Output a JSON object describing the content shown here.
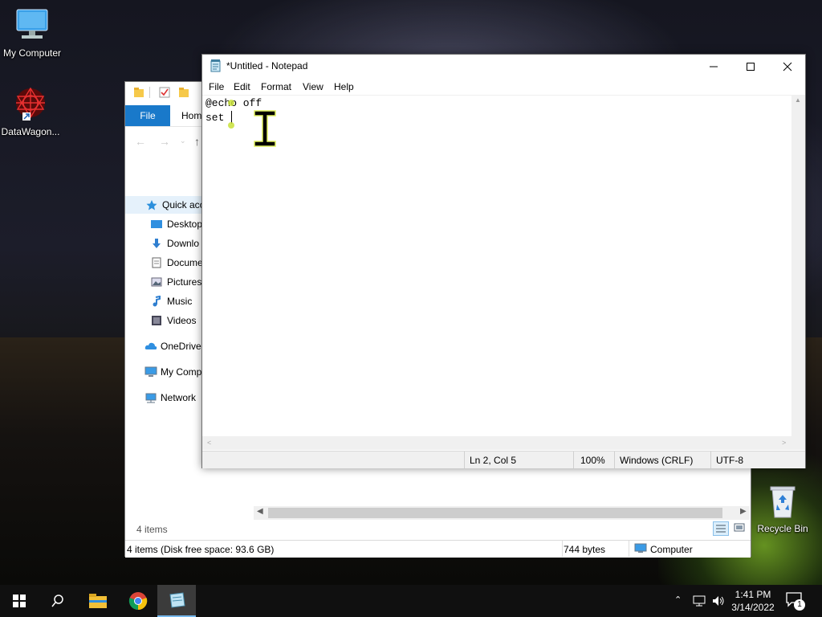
{
  "desktop": {
    "icons": [
      {
        "label": "My Computer",
        "icon": "my-computer-icon"
      },
      {
        "label": "DataWagon...",
        "icon": "datawagon-icon"
      },
      {
        "label": "Recycle Bin",
        "icon": "recycle-bin-icon"
      }
    ]
  },
  "explorer": {
    "tabs": {
      "file": "File",
      "home": "Hom"
    },
    "nav_items": [
      {
        "label": "Quick acc",
        "icon": "star-icon"
      },
      {
        "label": "Desktop",
        "icon": "desktop-folder-icon"
      },
      {
        "label": "Downlo",
        "icon": "download-icon"
      },
      {
        "label": "Docume",
        "icon": "document-icon"
      },
      {
        "label": "Pictures",
        "icon": "pictures-icon"
      },
      {
        "label": "Music",
        "icon": "music-icon"
      },
      {
        "label": "Videos",
        "icon": "video-icon"
      },
      {
        "label": "OneDrive",
        "icon": "onedrive-icon"
      },
      {
        "label": "My Comp",
        "icon": "computer-icon"
      },
      {
        "label": "Network",
        "icon": "network-icon"
      }
    ],
    "item_count": "4 items",
    "status": {
      "left": "4 items (Disk free space: 93.6 GB)",
      "size": "744 bytes",
      "location": "Computer"
    }
  },
  "notepad": {
    "title": "*Untitled - Notepad",
    "menu": [
      "File",
      "Edit",
      "Format",
      "View",
      "Help"
    ],
    "lines": [
      "@echo off",
      "set "
    ],
    "status": {
      "position": "Ln 2, Col 5",
      "zoom": "100%",
      "line_ending": "Windows (CRLF)",
      "encoding": "UTF-8"
    }
  },
  "taskbar": {
    "time": "1:41 PM",
    "date": "3/14/2022",
    "notification_count": "1",
    "apps": [
      "file-explorer-icon",
      "chrome-icon",
      "notepad-icon"
    ]
  }
}
